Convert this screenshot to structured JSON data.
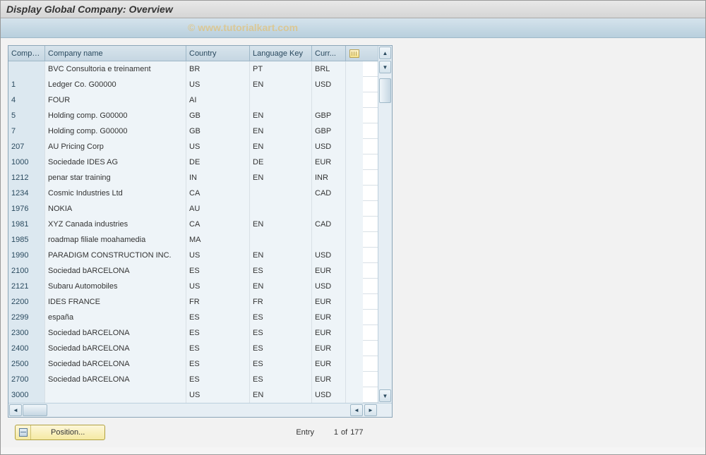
{
  "title": "Display Global Company: Overview",
  "watermark": "© www.tutorialkart.com",
  "table": {
    "columns": {
      "company": "Compa...",
      "name": "Company name",
      "country": "Country",
      "language": "Language Key",
      "currency": "Curr..."
    },
    "rows": [
      {
        "company": "",
        "name": "BVC Consultoria e treinament",
        "country": "BR",
        "lang": "PT",
        "curr": "BRL"
      },
      {
        "company": "1",
        "name": "Ledger Co. G00000",
        "country": "US",
        "lang": "EN",
        "curr": "USD"
      },
      {
        "company": "4",
        "name": "FOUR",
        "country": "AI",
        "lang": "",
        "curr": ""
      },
      {
        "company": "5",
        "name": "Holding comp. G00000",
        "country": "GB",
        "lang": "EN",
        "curr": "GBP"
      },
      {
        "company": "7",
        "name": "Holding comp. G00000",
        "country": "GB",
        "lang": "EN",
        "curr": "GBP"
      },
      {
        "company": "207",
        "name": "AU Pricing Corp",
        "country": "US",
        "lang": "EN",
        "curr": "USD"
      },
      {
        "company": "1000",
        "name": "Sociedade IDES AG",
        "country": "DE",
        "lang": "DE",
        "curr": "EUR"
      },
      {
        "company": "1212",
        "name": "penar star training",
        "country": "IN",
        "lang": "EN",
        "curr": "INR"
      },
      {
        "company": "1234",
        "name": "Cosmic Industries Ltd",
        "country": "CA",
        "lang": "",
        "curr": "CAD"
      },
      {
        "company": "1976",
        "name": "NOKIA",
        "country": "AU",
        "lang": "",
        "curr": ""
      },
      {
        "company": "1981",
        "name": "XYZ Canada industries",
        "country": "CA",
        "lang": "EN",
        "curr": "CAD"
      },
      {
        "company": "1985",
        "name": "roadmap filiale moahamedia",
        "country": "MA",
        "lang": "",
        "curr": ""
      },
      {
        "company": "1990",
        "name": "PARADIGM CONSTRUCTION INC.",
        "country": "US",
        "lang": "EN",
        "curr": "USD"
      },
      {
        "company": "2100",
        "name": "Sociedad bARCELONA",
        "country": "ES",
        "lang": "ES",
        "curr": "EUR"
      },
      {
        "company": "2121",
        "name": "Subaru Automobiles",
        "country": "US",
        "lang": "EN",
        "curr": "USD"
      },
      {
        "company": "2200",
        "name": "IDES FRANCE",
        "country": "FR",
        "lang": "FR",
        "curr": "EUR"
      },
      {
        "company": "2299",
        "name": "españa",
        "country": "ES",
        "lang": "ES",
        "curr": "EUR"
      },
      {
        "company": "2300",
        "name": "Sociedad bARCELONA",
        "country": "ES",
        "lang": "ES",
        "curr": "EUR"
      },
      {
        "company": "2400",
        "name": "Sociedad bARCELONA",
        "country": "ES",
        "lang": "ES",
        "curr": "EUR"
      },
      {
        "company": "2500",
        "name": "Sociedad bARCELONA",
        "country": "ES",
        "lang": "ES",
        "curr": "EUR"
      },
      {
        "company": "2700",
        "name": "Sociedad bARCELONA",
        "country": "ES",
        "lang": "ES",
        "curr": "EUR"
      },
      {
        "company": "3000",
        "name": "",
        "country": "US",
        "lang": "EN",
        "curr": "USD"
      }
    ]
  },
  "footer": {
    "position_label": "Position...",
    "entry_label": "Entry",
    "entry_current": "1",
    "entry_of": "of",
    "entry_total": "177"
  }
}
